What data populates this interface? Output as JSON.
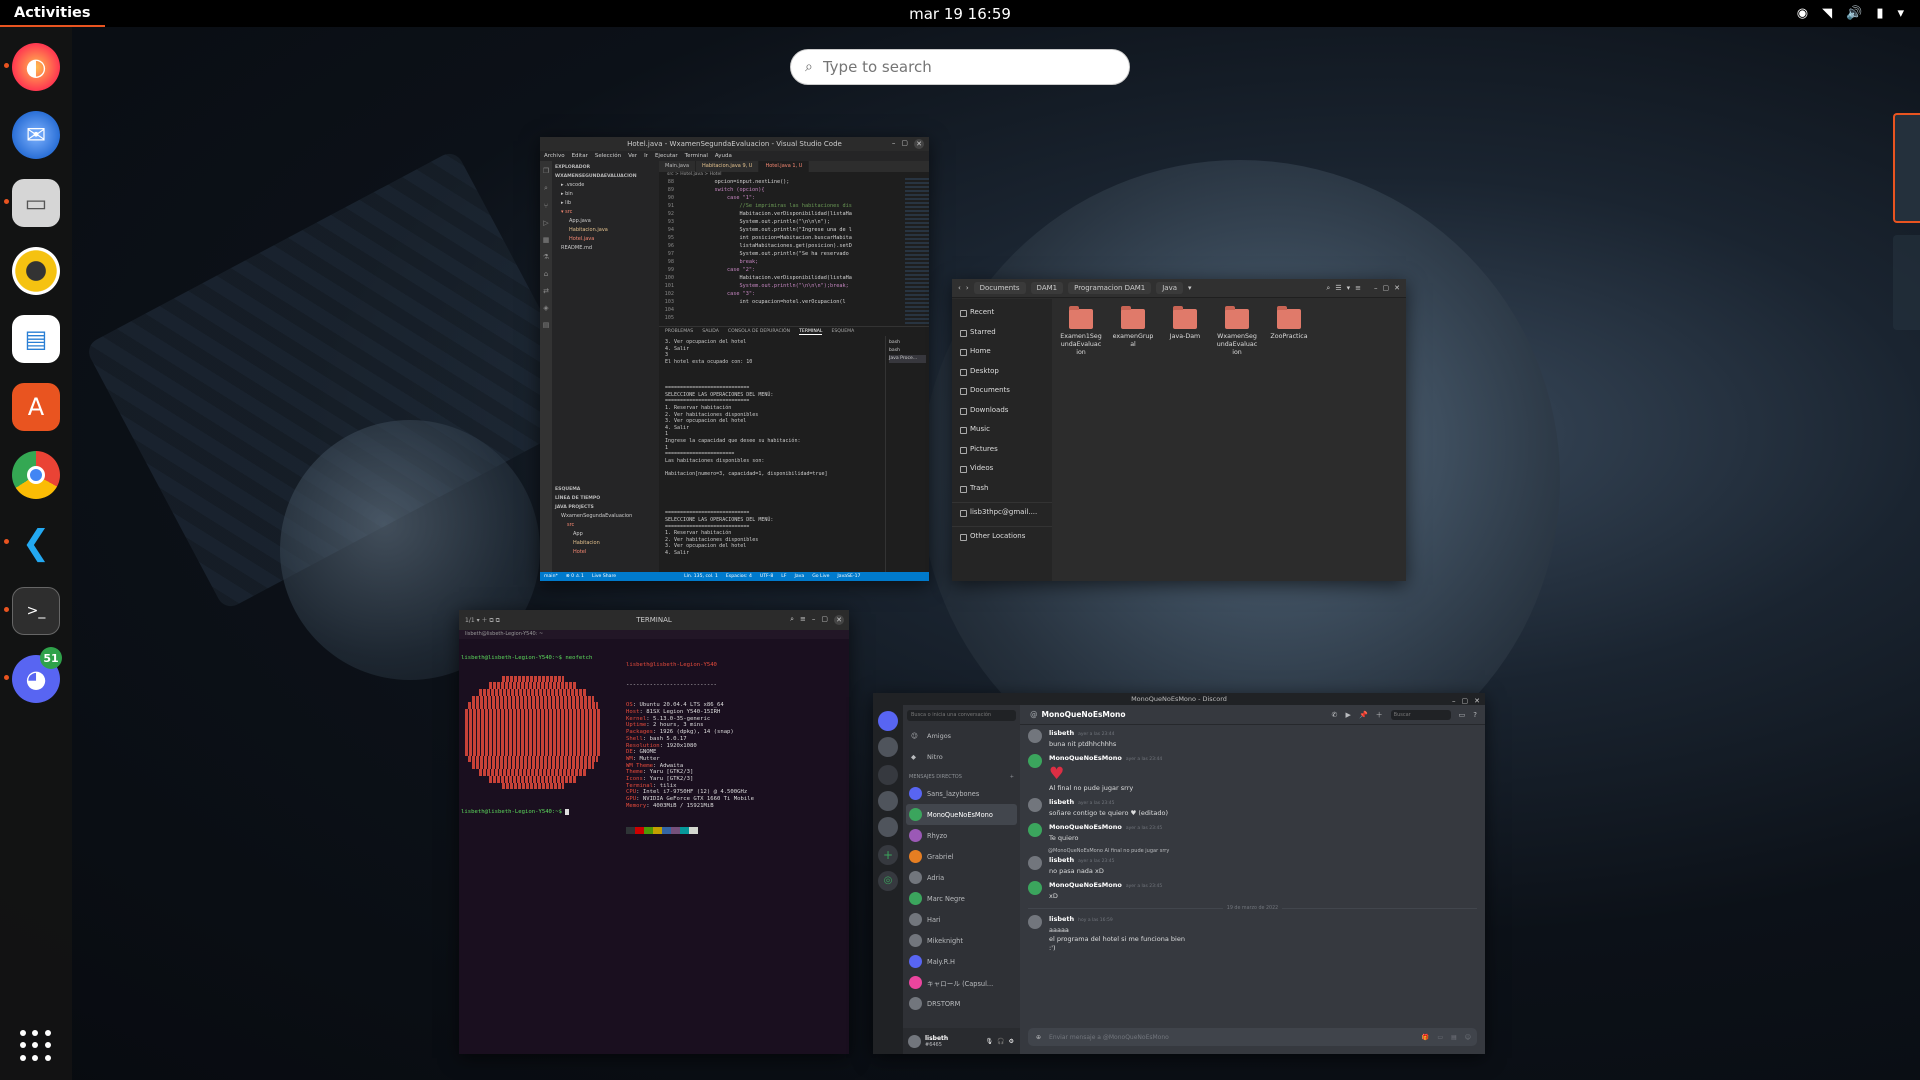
{
  "topbar": {
    "activities": "Activities",
    "clock": "mar 19  16:59"
  },
  "search": {
    "placeholder": "Type to search"
  },
  "dock": {
    "apps": [
      {
        "icon": "firefox-icon",
        "color": "#ff7139"
      },
      {
        "icon": "thunderbird-icon",
        "color": "#2a6fd6"
      },
      {
        "icon": "files-icon",
        "color": "#d6d6d6"
      },
      {
        "icon": "rhythmbox-icon",
        "color": "#f5c211"
      },
      {
        "icon": "libreoffice-writer-icon",
        "color": "#2a7fd4"
      },
      {
        "icon": "app-center-icon",
        "color": "#e95420"
      },
      {
        "icon": "chrome-icon",
        "color": "#34a853"
      },
      {
        "icon": "vscode-icon",
        "color": "#23a9f2"
      },
      {
        "icon": "terminal-icon",
        "color": "#2e2e2e"
      },
      {
        "icon": "discord-icon",
        "color": "#5865f2"
      }
    ],
    "discord_badge": "51"
  },
  "vscode": {
    "title": "Hotel.java - WxamenSegundaEvaluacion - Visual Studio Code",
    "menu": [
      "Archivo",
      "Editar",
      "Selección",
      "Ver",
      "Ir",
      "Ejecutar",
      "Terminal",
      "Ayuda"
    ],
    "tabs": [
      "Main.java",
      "Habitacion.java 9, U",
      "Hotel.java 1, U"
    ],
    "breadcrumb": "src > Hotel.java > Hotel",
    "explorer_title": "EXPLORADOR",
    "project": "WXAMENSEGUNDAEVALUACION",
    "tree": [
      ".vscode",
      "bin",
      "lib",
      "src",
      "App.java",
      "Habitacion.java",
      "Hotel.java",
      "README.md"
    ],
    "sections": [
      "ESQUEMA",
      "LÍNEA DE TIEMPO",
      "JAVA PROJECTS"
    ],
    "java_tree": [
      "WxamenSegundaEvaluacion",
      "src",
      "App",
      "Habitacion",
      "Hotel"
    ],
    "line_numbers": [
      "88",
      "89",
      "90",
      "91",
      "92",
      "93",
      "94",
      "95",
      "96",
      "97",
      "98",
      "99",
      "100",
      "101",
      "102",
      "103",
      "104",
      "105"
    ],
    "code": [
      "            opcion=input.nextLine();",
      "            switch (opcion){",
      "                case \"1\":",
      "                    //Se imprimiras las habitaciones dis",
      "                    Habitacion.verDisponibilidad(listaHa",
      "                    System.out.println(\"\\n\\n\\n\");",
      "                    System.out.println(\"Ingrese una de l",
      "                    int posicion=Habitacion.buscarHabita",
      "                    listaHabitaciones.get(posicion).setD",
      "                    System.out.println(\"Se ha reservado",
      "                    break;",
      "                case \"2\":",
      "                    Habitacion.verDisponibilidad(listaHa",
      "                    System.out.println(\"\\n\\n\\n\");break;",
      "                case \"3\":",
      "                    int ocupacion=hotel.verOcupacion(l"
    ],
    "panel_tabs": [
      "PROBLEMAS",
      "SALIDA",
      "CONSOLA DE DEPURACIÓN",
      "TERMINAL",
      "ESQUEMA"
    ],
    "terminal_lines": [
      "3. Ver opcupacion del hotel",
      "4. Salir",
      "3",
      "El hotel esta ocupado con: 10",
      "",
      "",
      "",
      "============================",
      "SELECCIONE LAS OPERACIONES DEL MENÚ:",
      "============================",
      "1. Reservar habitación",
      "2. Ver habitaciones disponibles",
      "3. Ver opcupacion del hotel",
      "4. Salir",
      "1",
      "Ingrese la capacidad que desee su habitación:",
      "1",
      "=======================",
      "Las habitaciones disponibles son:",
      "",
      "Habitacion[numero=3, capacidad=1, disponibilidad=true]",
      "",
      "",
      "",
      "",
      "",
      "============================",
      "SELECCIONE LAS OPERACIONES DEL MENÚ:",
      "============================",
      "1. Reservar habitación",
      "2. Ver habitaciones disponibles",
      "3. Ver opcupacion del hotel",
      "4. Salir"
    ],
    "term_list": [
      "bash",
      "bash",
      "Java Proce..."
    ],
    "status": [
      "main*",
      "⊗ 0 ⚠ 1",
      "Live Share",
      "Lín. 135, col. 1",
      "Espacios: 4",
      "UTF-8",
      "LF",
      "Java",
      "Go Live",
      "JavaSE-17"
    ]
  },
  "files": {
    "crumbs": [
      "Documents",
      "DAM1",
      "Programacion DAM1",
      "Java"
    ],
    "sidebar": [
      "Recent",
      "Starred",
      "Home",
      "Desktop",
      "Documents",
      "Downloads",
      "Music",
      "Pictures",
      "Videos",
      "Trash",
      "lisb3thpc@gmail....",
      "Other Locations"
    ],
    "items": [
      "Examen1SegundaEvaluacion",
      "examenGrupal",
      "Java-Dam",
      "WxamenSegundaEvaluacion",
      "ZooPractica"
    ]
  },
  "terminal": {
    "title": "TERMINAL",
    "tab": "lisbeth@lisbeth-Legion-Y540: ~",
    "prompt": "lisbeth@lisbeth-Legion-Y540:~$ neofetch",
    "prompt2": "lisbeth@lisbeth-Legion-Y540:~$ ",
    "header": "lisbeth@lisbeth-Legion-Y540",
    "info": [
      [
        "OS",
        "Ubuntu 20.04.4 LTS x86_64"
      ],
      [
        "Host",
        "81SX Legion Y540-15IRH"
      ],
      [
        "Kernel",
        "5.13.0-35-generic"
      ],
      [
        "Uptime",
        "2 hours, 3 mins"
      ],
      [
        "Packages",
        "1926 (dpkg), 14 (snap)"
      ],
      [
        "Shell",
        "bash 5.0.17"
      ],
      [
        "Resolution",
        "1920x1080"
      ],
      [
        "DE",
        "GNOME"
      ],
      [
        "WM",
        "Mutter"
      ],
      [
        "WM Theme",
        "Adwaita"
      ],
      [
        "Theme",
        "Yaru [GTK2/3]"
      ],
      [
        "Icons",
        "Yaru [GTK2/3]"
      ],
      [
        "Terminal",
        "tilix"
      ],
      [
        "CPU",
        "Intel i7-9750HF (12) @ 4.500GHz"
      ],
      [
        "GPU",
        "NVIDIA GeForce GTX 1660 Ti Mobile"
      ],
      [
        "Memory",
        "4003MiB / 15921MiB"
      ]
    ],
    "palette": [
      "#2e3436",
      "#cc0000",
      "#4e9a06",
      "#c4a000",
      "#3465a4",
      "#75507b",
      "#06989a",
      "#d3d7cf"
    ]
  },
  "discord": {
    "title": "MonoQueNoEsMono - Discord",
    "search_placeholder": "Busca o inicia una conversación",
    "nav": [
      "Amigos",
      "Nitro"
    ],
    "dm_header": "MENSAJES DIRECTOS",
    "dms": [
      {
        "name": "Sans_lazybones",
        "color": "#5865f2"
      },
      {
        "name": "MonoQueNoEsMono",
        "color": "#3ba55d"
      },
      {
        "name": "Rhyzo",
        "color": "#9b59b6"
      },
      {
        "name": "Grabriel",
        "color": "#e67e22"
      },
      {
        "name": "Adria",
        "color": "#72767d"
      },
      {
        "name": "Marc Negre",
        "color": "#3ba55d"
      },
      {
        "name": "Hari",
        "color": "#72767d"
      },
      {
        "name": "Mikeknight",
        "color": "#72767d"
      },
      {
        "name": "Maly.R.H",
        "color": "#5865f2"
      },
      {
        "name": "キャロール (Capsul...",
        "color": "#eb459e"
      },
      {
        "name": "DRSTORM",
        "color": "#72767d"
      }
    ],
    "user": {
      "name": "lisbeth",
      "tag": "#6465"
    },
    "chat_title": "MonoQueNoEsMono",
    "chat_search": "Buscar",
    "messages": [
      {
        "who": "lisbeth",
        "ts": "ayer a las 23:44",
        "txt": "buna nit ptdhhchhhs"
      },
      {
        "who": "MonoQueNoEsMono",
        "ts": "ayer a las 23:44",
        "txt": "Al final no pude jugar srry",
        "heart": true
      },
      {
        "who": "lisbeth",
        "ts": "ayer a las 23:45",
        "txt": "soñare contigo te quiero ♥ (editado)"
      },
      {
        "who": "MonoQueNoEsMono",
        "ts": "ayer a las 23:45",
        "txt": "Te quiero"
      },
      {
        "who": "lisbeth",
        "ts": "ayer a las 23:45",
        "txt": "no pasa nada xD",
        "reply": "@MonoQueNoEsMono Al final no pude jugar srry"
      },
      {
        "who": "MonoQueNoEsMono",
        "ts": "ayer a las 23:45",
        "txt": "xD"
      }
    ],
    "divider": "19 de marzo de 2022",
    "last_msg": {
      "who": "lisbeth",
      "ts": "hoy a las 16:59",
      "lines": [
        "aaaaa",
        "el programa del hotel si me funciona bien",
        ":')"
      ]
    },
    "input_placeholder": "Enviar mensaje a @MonoQueNoEsMono"
  }
}
